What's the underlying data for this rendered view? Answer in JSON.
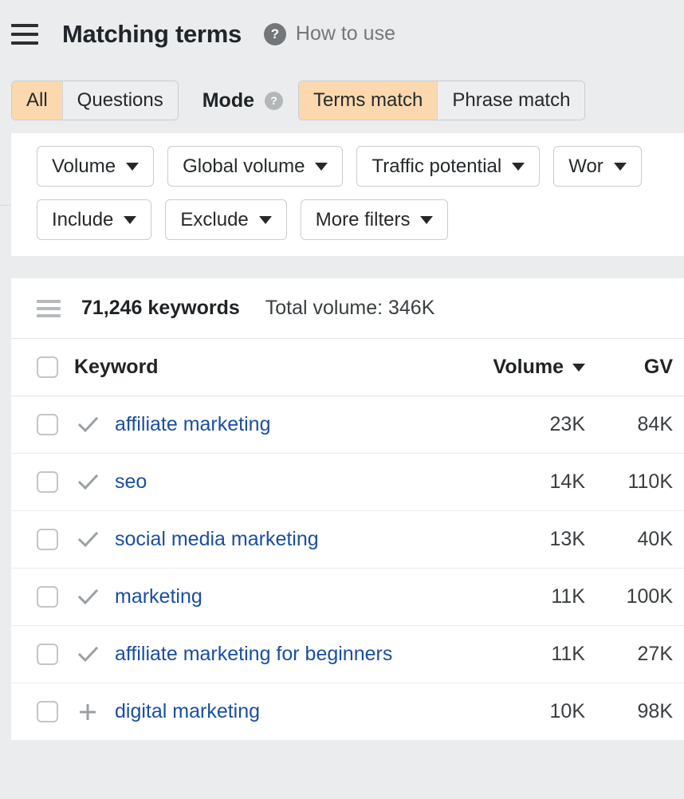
{
  "header": {
    "menu_icon": "hamburger-icon",
    "title": "Matching terms",
    "help_icon": "question-mark-icon",
    "how_to_use": "How to use"
  },
  "toolbar": {
    "type_tabs": [
      {
        "label": "All",
        "active": true
      },
      {
        "label": "Questions",
        "active": false
      }
    ],
    "mode_label": "Mode",
    "mode_help_icon": "question-mark-icon",
    "mode_tabs": [
      {
        "label": "Terms match",
        "active": true
      },
      {
        "label": "Phrase match",
        "active": false
      }
    ]
  },
  "filters": {
    "row1": [
      {
        "label": "Volume"
      },
      {
        "label": "Global volume"
      },
      {
        "label": "Traffic potential"
      },
      {
        "label": "Wor"
      }
    ],
    "row2": [
      {
        "label": "Include"
      },
      {
        "label": "Exclude"
      },
      {
        "label": "More filters"
      }
    ]
  },
  "results": {
    "list_icon": "list-view-icon",
    "keyword_count": "71,246 keywords",
    "total_volume": "Total volume: 346K",
    "columns": {
      "select_all": "select-all-checkbox",
      "keyword": "Keyword",
      "volume": "Volume",
      "gv": "GV"
    },
    "rows": [
      {
        "mark": "check",
        "keyword": "affiliate marketing",
        "volume": "23K",
        "gv": "84K"
      },
      {
        "mark": "check",
        "keyword": "seo",
        "volume": "14K",
        "gv": "110K"
      },
      {
        "mark": "check",
        "keyword": "social media marketing",
        "volume": "13K",
        "gv": "40K"
      },
      {
        "mark": "check",
        "keyword": "marketing",
        "volume": "11K",
        "gv": "100K"
      },
      {
        "mark": "check",
        "keyword": "affiliate marketing for beginners",
        "volume": "11K",
        "gv": "27K"
      },
      {
        "mark": "plus",
        "keyword": "digital marketing",
        "volume": "10K",
        "gv": "98K"
      }
    ]
  },
  "colors": {
    "page_bg": "#eaecee",
    "panel_bg": "#ffffff",
    "accent_active": "#fcd8ae",
    "link": "#1a4fa0",
    "muted_text": "#74787a",
    "border": "#c9cdd0"
  }
}
